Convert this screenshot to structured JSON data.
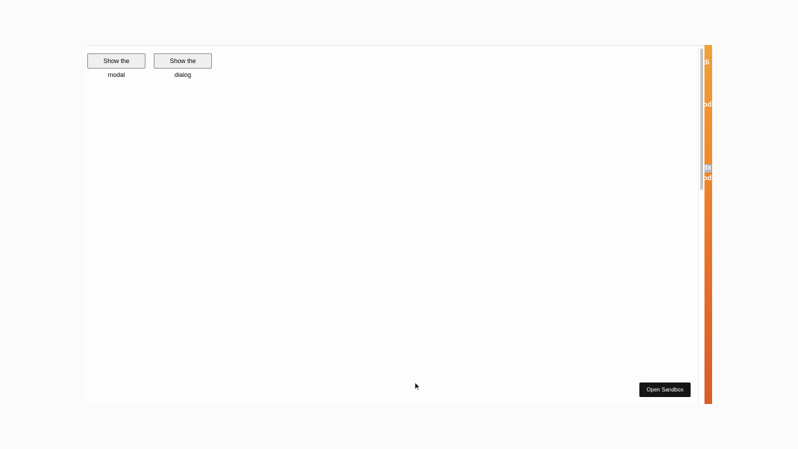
{
  "desktop": {
    "labels": [
      {
        "text": "di",
        "highlight": false
      },
      {
        "text": "od",
        "highlight": false
      },
      {
        "text": ".tx",
        "highlight": true
      },
      {
        "text": "od",
        "highlight": false
      }
    ]
  },
  "app": {
    "buttons": {
      "show_modal": "Show the modal",
      "show_dialog": "Show the dialog"
    },
    "open_sandbox": "Open Sandbox"
  },
  "colors": {
    "desktop_orange": "#f28a2a",
    "sandbox_button_bg": "#151515",
    "page_bg": "#fdfdfd"
  },
  "icons": {
    "cursor": "arrow-cursor-icon"
  }
}
